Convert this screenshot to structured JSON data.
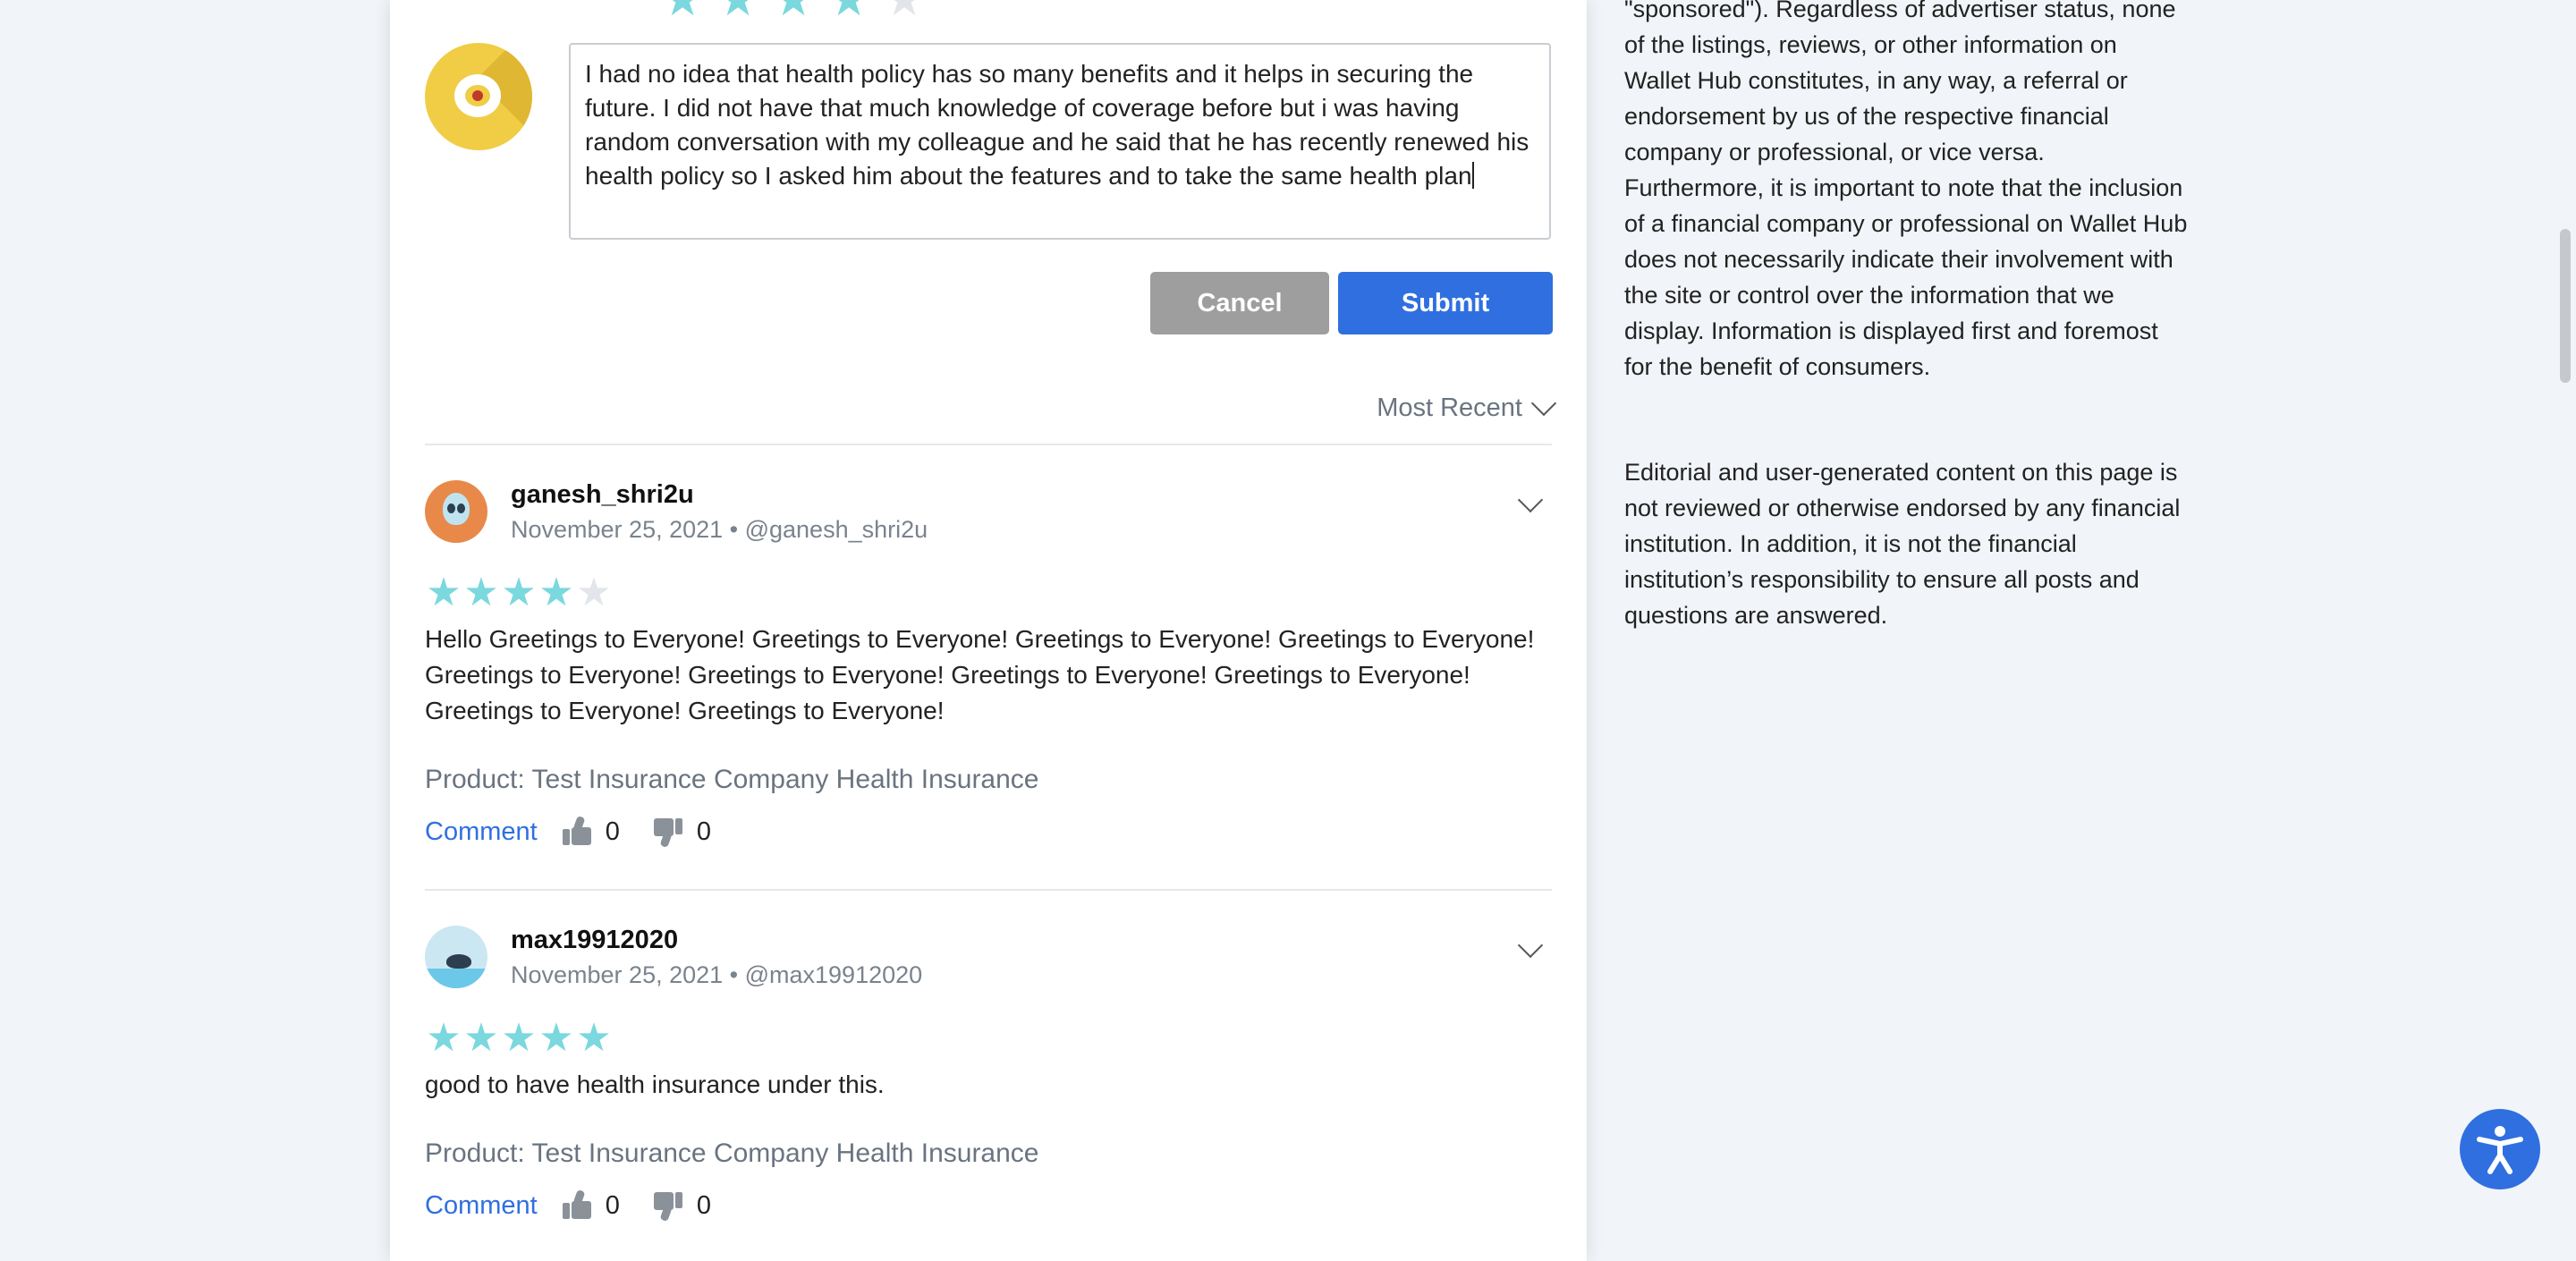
{
  "compose": {
    "text": "I had no idea that health policy has so many benefits and it helps in securing the future. I did not have that much knowledge of coverage before but i was having random conversation with my colleague and he said that he has recently renewed his health policy so I asked him about the features and to take the same health plan",
    "cancel_label": "Cancel",
    "submit_label": "Submit",
    "rating": 4
  },
  "sort": {
    "label": "Most Recent"
  },
  "reviews": [
    {
      "username": "ganesh_shri2u",
      "meta": "November 25, 2021 • @ganesh_shri2u",
      "rating": 4,
      "text": "Hello Greetings to Everyone! Greetings to Everyone! Greetings to Everyone! Greetings to Everyone! Greetings to Everyone! Greetings to Everyone! Greetings to Everyone! Greetings to Everyone! Greetings to Everyone! Greetings to Everyone!",
      "product": "Product: Test Insurance Company Health Insurance",
      "comment_label": "Comment",
      "likes": "0",
      "dislikes": "0"
    },
    {
      "username": "max19912020",
      "meta": "November 25, 2021 • @max19912020",
      "rating": 5,
      "text": "good to have health insurance under this.",
      "product": "Product: Test Insurance Company Health Insurance",
      "comment_label": "Comment",
      "likes": "0",
      "dislikes": "0"
    }
  ],
  "sidebar": {
    "disclaimer_1": "\"sponsored\"). Regardless of advertiser status, none of the listings, reviews, or other information on Wallet Hub constitutes, in any way, a referral or endorsement by us of the respective financial company or professional, or vice versa. Furthermore, it is important to note that the inclusion of a financial company or professional on Wallet Hub does not necessarily indicate their involvement with the site or control over the information that we display. Information is displayed first and foremost for the benefit of consumers.",
    "disclaimer_2": "Editorial and user-generated content on this page is not reviewed or otherwise endorsed by any financial institution. In addition, it is not the financial institution’s responsibility to ensure all posts and questions are answered."
  },
  "colors": {
    "accent": "#2f6fe0",
    "star": "#7ad8de",
    "star_off": "#e2e6ea",
    "cancel": "#9e9e9e"
  },
  "icons": {
    "thumbs_up": "thumbs-up-icon",
    "thumbs_down": "thumbs-down-icon",
    "accessibility": "accessibility-icon"
  }
}
